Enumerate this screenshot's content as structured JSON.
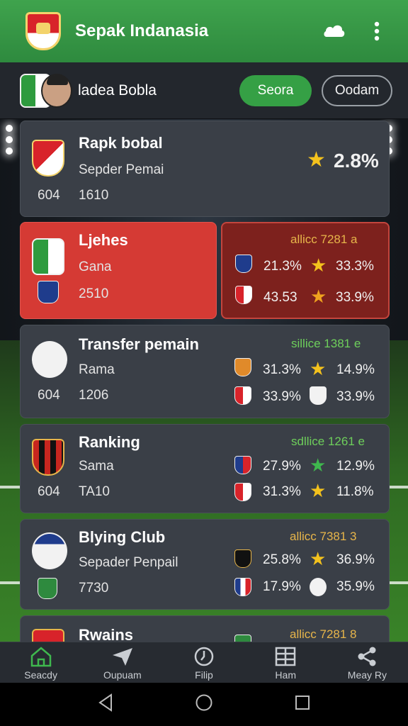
{
  "app": {
    "title": "Sepak Indanasia"
  },
  "profile": {
    "name": "ladea Bobla",
    "primary_button": "Seora",
    "secondary_button": "Oodam"
  },
  "cards": [
    {
      "title": "Rapk bobal",
      "subtitle": "Sepder Pemai",
      "num1": "604",
      "num2": "1610",
      "rating": "2.8%"
    },
    {
      "title": "Ljehes",
      "subtitle": "Gana",
      "num2": "2510",
      "badge": "allicc 7281 a",
      "stats": [
        "21.3%",
        "33.3%",
        "43.53",
        "33.9%"
      ]
    },
    {
      "title": "Transfer pemain",
      "subtitle": "Rama",
      "num1": "604",
      "num2": "1206",
      "badge": "sillice 1381 e",
      "stats": [
        "31.3%",
        "14.9%",
        "33.9%",
        "33.9%"
      ]
    },
    {
      "title": "Ranking",
      "subtitle": "Sama",
      "num1": "604",
      "num2": "TA10",
      "badge": "sdllice 1261 e",
      "stats": [
        "27.9%",
        "12.9%",
        "31.3%",
        "11.8%"
      ]
    },
    {
      "title": "Blying Club",
      "subtitle": "Sepader Penpail",
      "num2": "7730",
      "badge": "allicc 7381 3",
      "stats": [
        "25.8%",
        "36.9%",
        "17.9%",
        "35.9%"
      ]
    },
    {
      "title": "Rwains",
      "badge": "allicc 7281 8"
    }
  ],
  "nav": [
    {
      "label": "Seacdy",
      "icon": "home-icon"
    },
    {
      "label": "Oupuam",
      "icon": "send-icon"
    },
    {
      "label": "Filip",
      "icon": "clock-icon"
    },
    {
      "label": "Ham",
      "icon": "grid-icon"
    },
    {
      "label": "Meay Ry",
      "icon": "share-icon"
    }
  ],
  "colors": {
    "header": "#3fa34d",
    "accent_green": "#35a045",
    "highlight_red": "#d53a34",
    "card_bg": "#3a3f47"
  }
}
